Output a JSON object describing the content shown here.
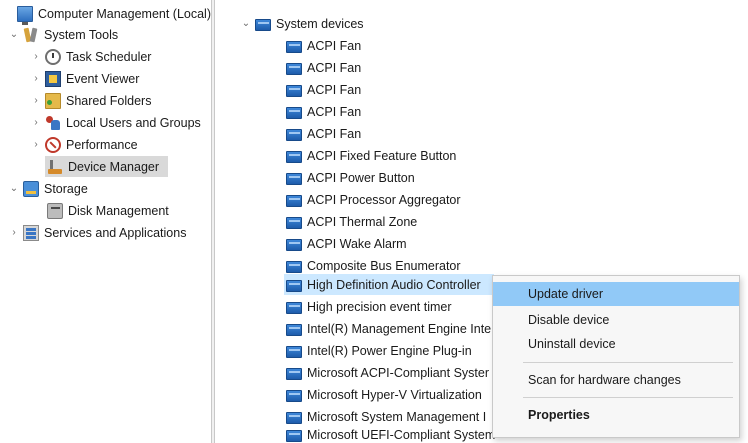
{
  "left_tree": {
    "root": "Computer Management (Local)",
    "system_tools": "System Tools",
    "task_scheduler": "Task Scheduler",
    "event_viewer": "Event Viewer",
    "shared_folders": "Shared Folders",
    "local_users": "Local Users and Groups",
    "performance": "Performance",
    "device_manager": "Device Manager",
    "storage": "Storage",
    "disk_management": "Disk Management",
    "services_apps": "Services and Applications"
  },
  "device_tree": {
    "category": "System devices",
    "devices": [
      "ACPI Fan",
      "ACPI Fan",
      "ACPI Fan",
      "ACPI Fan",
      "ACPI Fan",
      "ACPI Fixed Feature Button",
      "ACPI Power Button",
      "ACPI Processor Aggregator",
      "ACPI Thermal Zone",
      "ACPI Wake Alarm",
      "Composite Bus Enumerator",
      "High Definition Audio Controller",
      "High precision event timer",
      "Intel(R) Management Engine Inte",
      "Intel(R) Power Engine Plug-in",
      "Microsoft ACPI-Compliant Syster",
      "Microsoft Hyper-V Virtualization",
      "Microsoft System Management I",
      "Microsoft UEFI-Compliant System"
    ]
  },
  "context_menu": {
    "update_driver": "Update driver",
    "disable_device": "Disable device",
    "uninstall_device": "Uninstall device",
    "scan_hardware": "Scan for hardware changes",
    "properties": "Properties"
  },
  "colors": {
    "menu_highlight": "#91c9f7",
    "selected_row": "#d9d9d9",
    "hover_row": "#cce8ff"
  }
}
